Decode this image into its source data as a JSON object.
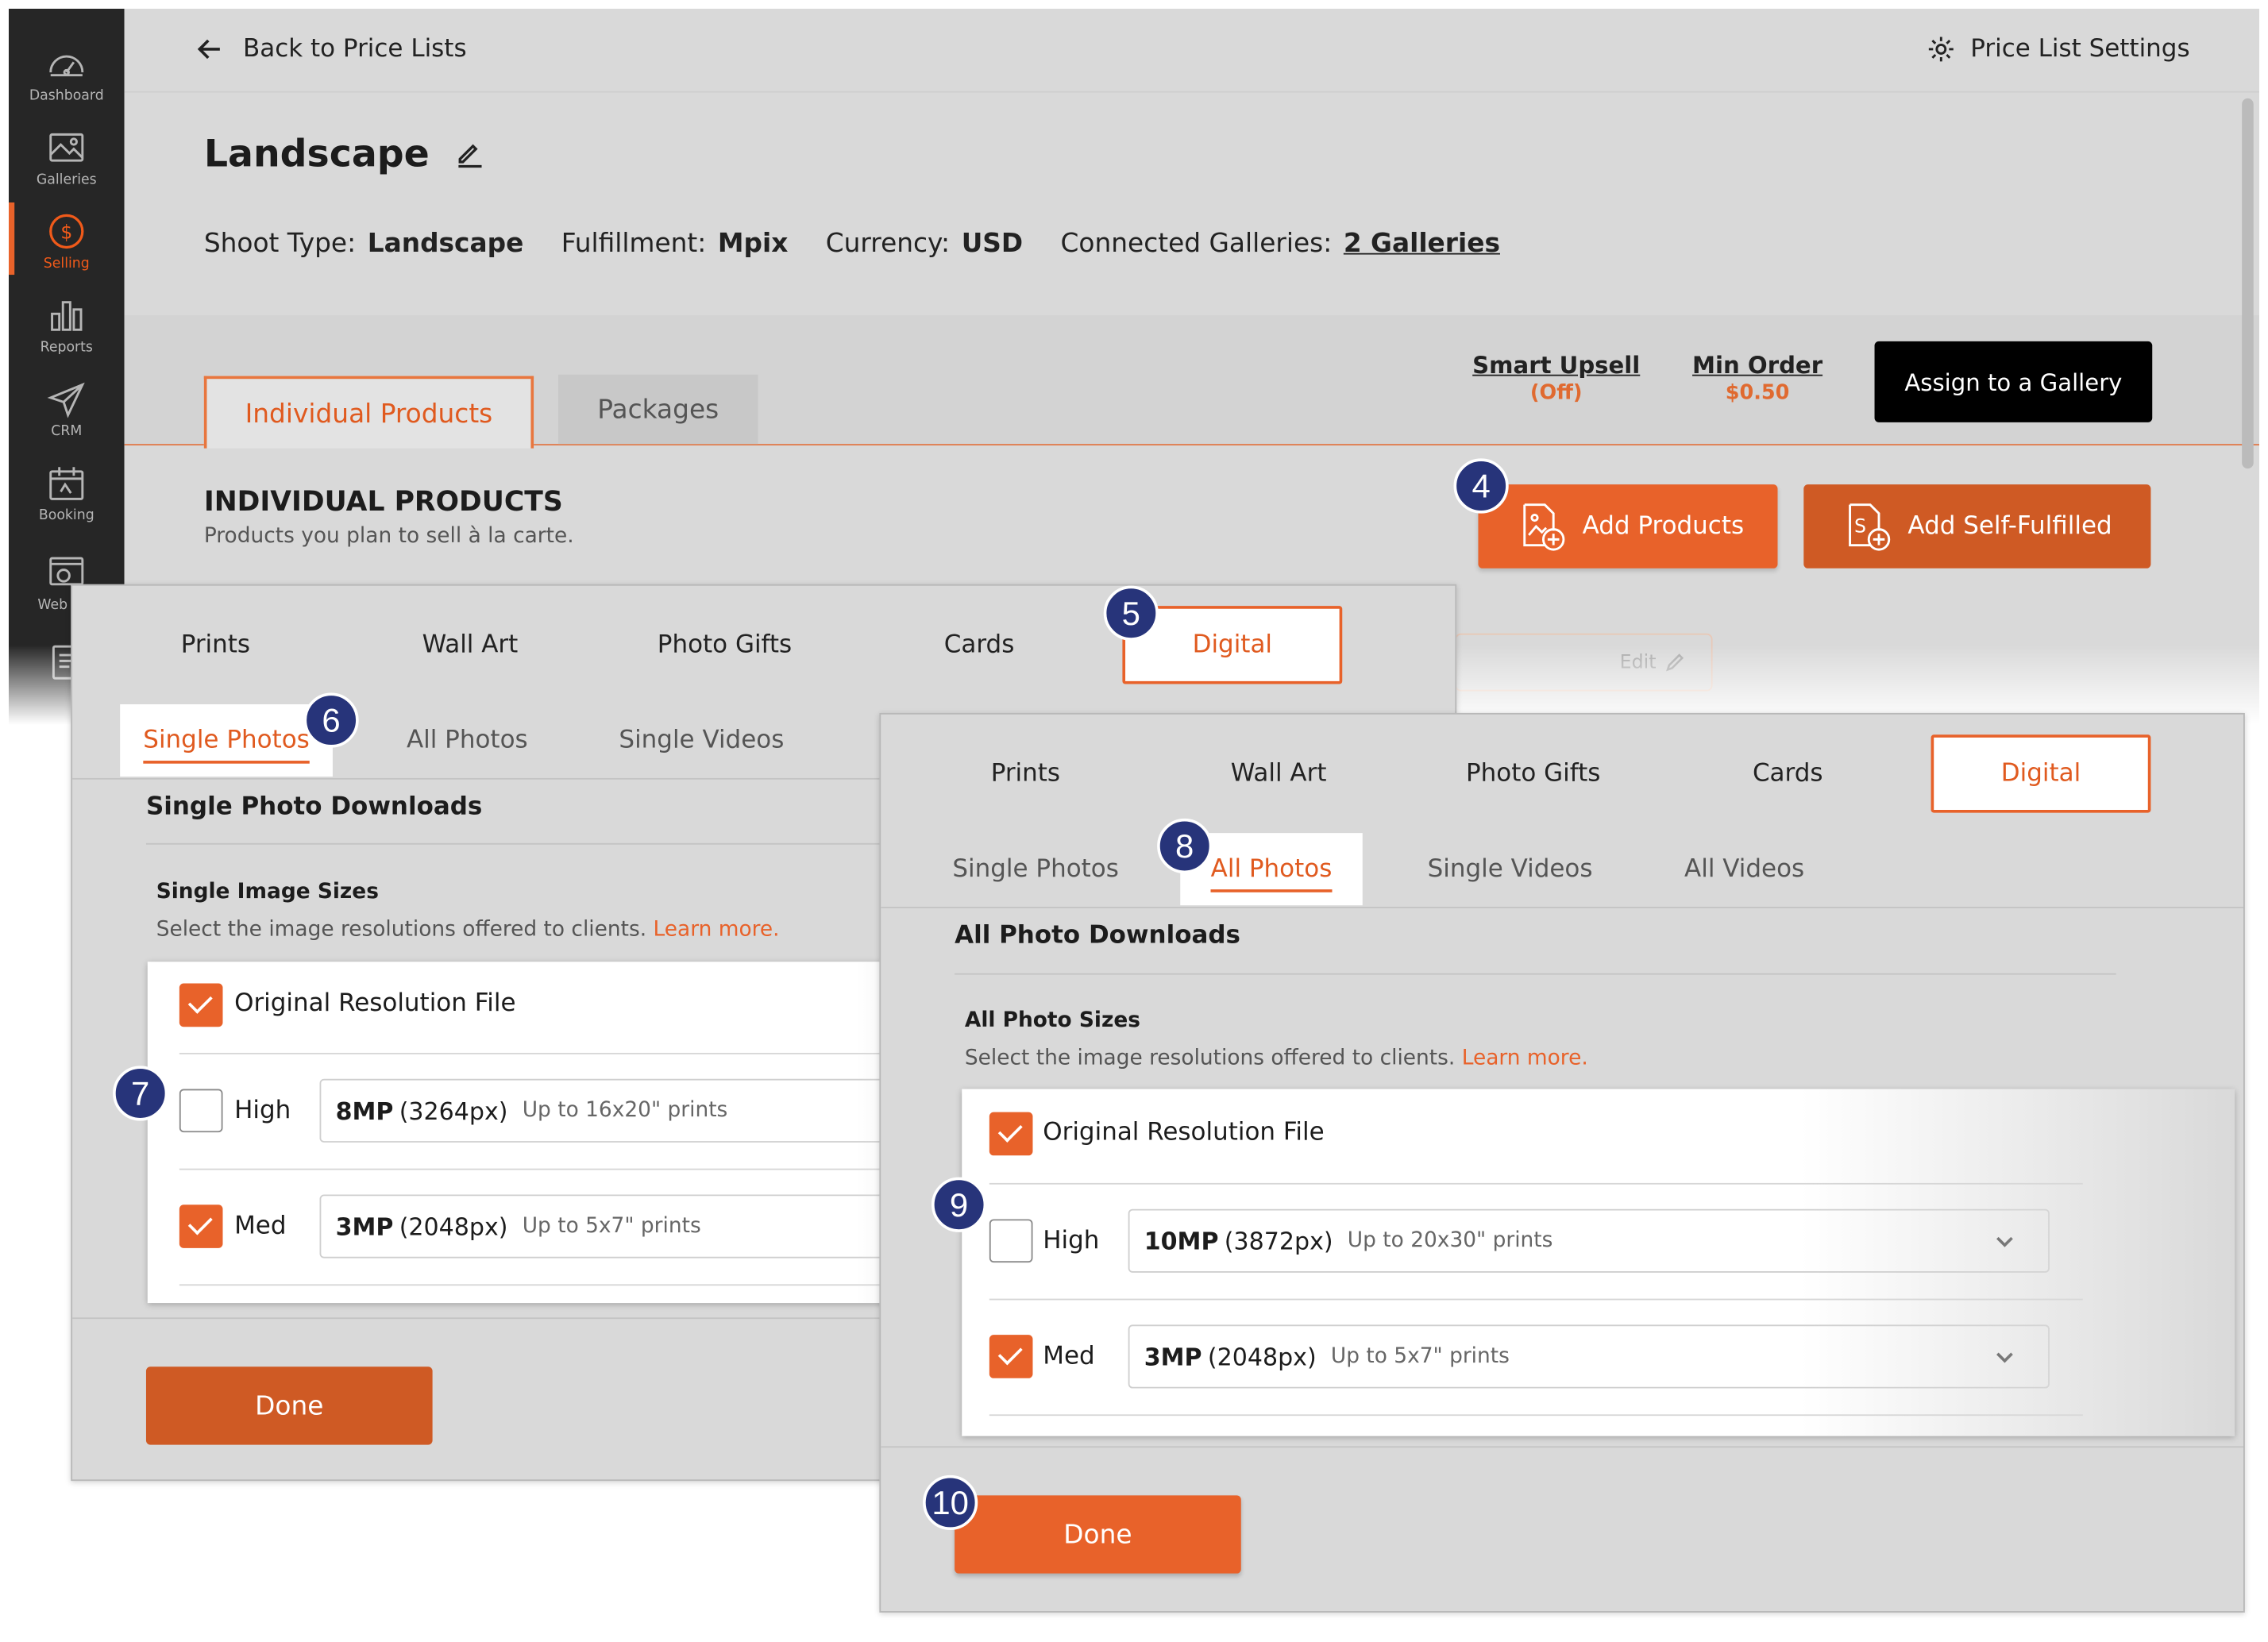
{
  "header": {
    "back_label": "Back to Price Lists",
    "settings_label": "Price List Settings"
  },
  "sidebar": {
    "items": [
      {
        "label": "Dashboard",
        "icon": "gauge-icon"
      },
      {
        "label": "Galleries",
        "icon": "image-icon"
      },
      {
        "label": "Selling",
        "icon": "dollar-icon"
      },
      {
        "label": "Reports",
        "icon": "bar-chart-icon"
      },
      {
        "label": "CRM",
        "icon": "paper-plane-icon"
      },
      {
        "label": "Booking",
        "icon": "calendar-icon"
      },
      {
        "label": "Web",
        "icon": "website-icon"
      }
    ]
  },
  "pricelist": {
    "title": "Landscape",
    "shoot_type_label": "Shoot Type:",
    "shoot_type": "Landscape",
    "fulfillment_label": "Fulfillment:",
    "fulfillment": "Mpix",
    "currency_label": "Currency:",
    "currency": "USD",
    "galleries_label": "Connected Galleries:",
    "galleries": "2 Galleries"
  },
  "tabs": {
    "individual": "Individual Products",
    "packages": "Packages"
  },
  "upsell": {
    "label": "Smart Upsell",
    "value": "(Off)"
  },
  "min_order": {
    "label": "Min Order",
    "value": "$0.50"
  },
  "assign_label": "Assign to a Gallery",
  "section": {
    "heading": "INDIVIDUAL PRODUCTS",
    "subtitle": "Products you plan to sell à la carte."
  },
  "buttons": {
    "add_products": "Add Products",
    "add_self": "Add Self-Fulfilled",
    "edit": "Edit"
  },
  "product_tabs": [
    "Prints",
    "Wall Art",
    "Photo Gifts",
    "Cards",
    "Digital"
  ],
  "panel1": {
    "subtabs": [
      "Single Photos",
      "All Photos",
      "Single Videos"
    ],
    "downloads_title": "Single Photo Downloads",
    "sizes_title": "Single Image Sizes",
    "sizes_sub": "Select the image resolutions offered to clients.",
    "learn_more": "Learn more.",
    "original": "Original Resolution File",
    "high_label": "High",
    "high_mp": "8MP",
    "high_px": "(3264px)",
    "high_note": "Up to 16x20\" prints",
    "med_label": "Med",
    "med_mp": "3MP",
    "med_px": "(2048px)",
    "med_note": "Up to 5x7\" prints",
    "done": "Done"
  },
  "panel2": {
    "subtabs": [
      "Single Photos",
      "All Photos",
      "Single Videos",
      "All Videos"
    ],
    "downloads_title": "All Photo Downloads",
    "sizes_title": "All Photo Sizes",
    "sizes_sub": "Select the image resolutions offered to clients.",
    "learn_more": "Learn more.",
    "original": "Original Resolution File",
    "high_label": "High",
    "high_mp": "10MP",
    "high_px": "(3872px)",
    "high_note": "Up to 20x30\" prints",
    "med_label": "Med",
    "med_mp": "3MP",
    "med_px": "(2048px)",
    "med_note": "Up to 5x7\" prints",
    "done": "Done"
  },
  "steps": [
    "4",
    "5",
    "6",
    "7",
    "8",
    "9",
    "10"
  ],
  "colors": {
    "accent": "#e8622a",
    "accent_dark": "#cf5a24",
    "sidebar": "#262626",
    "step_badge": "#27347a"
  }
}
